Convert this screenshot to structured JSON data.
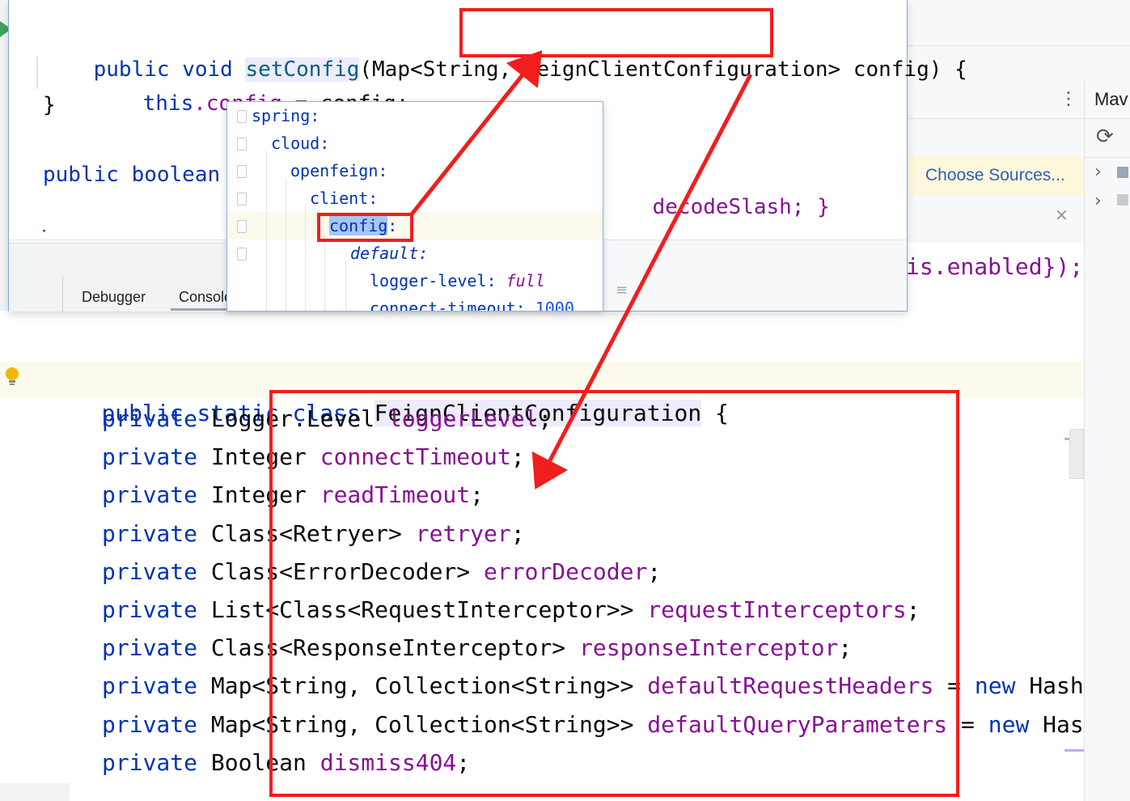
{
  "right_panel": {
    "maven_label": "Mav",
    "choose_sources": "Choose Sources...",
    "overflow_right": "is.enabled});"
  },
  "popup": {
    "line1_kw": "public void ",
    "line1_method": "setConfig",
    "line1_a": "(Map<String, ",
    "line1_type": "FeignClientConfiguration>",
    "line1_b": " config) {",
    "line2_this": "this",
    "line2_field": ".config",
    "line2_rest": " = config;",
    "line3": "}",
    "line4_kw": "public boolean",
    "line4_right": "decodeSlash; }",
    "tabs": [
      "Debugger",
      "Console"
    ]
  },
  "yaml": {
    "lines": [
      "spring:",
      "cloud:",
      "openfeign:",
      "client:",
      "config",
      "default:",
      "logger-level: ",
      "connect-timeout: "
    ],
    "config_colon": ":",
    "logger_value": "full",
    "timeout_value": "1000"
  },
  "editor": {
    "class_decl_kw": "public static class ",
    "class_decl_name": "FeignClientConfiguration",
    "class_decl_end": " {",
    "fields": [
      {
        "kw": "private ",
        "type": "Logger.Level ",
        "name": "loggerLevel",
        "end": ";"
      },
      {
        "kw": "private ",
        "type": "Integer ",
        "name": "connectTimeout",
        "end": ";"
      },
      {
        "kw": "private ",
        "type": "Integer ",
        "name": "readTimeout",
        "end": ";"
      },
      {
        "kw": "private ",
        "type": "Class<Retryer> ",
        "name": "retryer",
        "end": ";"
      },
      {
        "kw": "private ",
        "type": "Class<ErrorDecoder> ",
        "name": "errorDecoder",
        "end": ";"
      },
      {
        "kw": "private ",
        "type": "List<Class<RequestInterceptor>> ",
        "name": "requestInterceptors",
        "end": ";"
      },
      {
        "kw": "private ",
        "type": "Class<ResponseInterceptor> ",
        "name": "responseInterceptor",
        "end": ";"
      },
      {
        "kw": "private ",
        "type": "Map<String, Collection<String>> ",
        "name": "defaultRequestHeaders",
        "end": " = new Hash"
      },
      {
        "kw": "private ",
        "type": "Map<String, Collection<String>> ",
        "name": "defaultQueryParameters",
        "end": " = new Has"
      },
      {
        "kw": "private ",
        "type": "Boolean ",
        "name": "dismiss404",
        "end": ";"
      }
    ]
  },
  "colors": {
    "keyword": "#0033b3",
    "field": "#871094",
    "annotation_red": "#f21d1d"
  }
}
